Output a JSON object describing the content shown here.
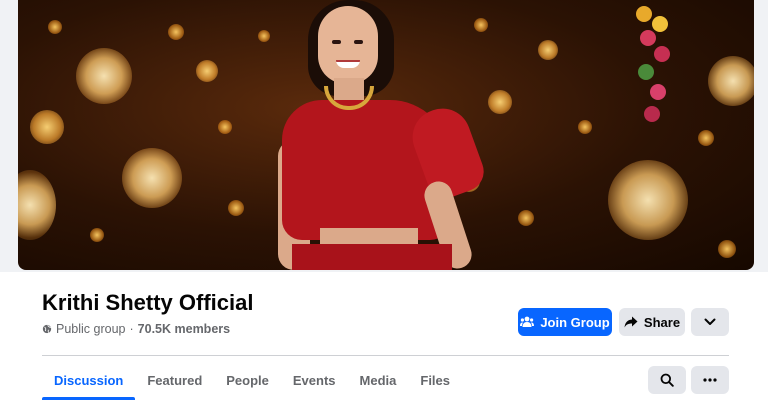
{
  "group": {
    "name": "Krithi Shetty Official",
    "privacy": "Public group",
    "separator": "·",
    "members": "70.5K members"
  },
  "actions": {
    "join_label": "Join Group",
    "share_label": "Share"
  },
  "tabs": [
    {
      "label": "Discussion",
      "active": true
    },
    {
      "label": "Featured",
      "active": false
    },
    {
      "label": "People",
      "active": false
    },
    {
      "label": "Events",
      "active": false
    },
    {
      "label": "Media",
      "active": false
    },
    {
      "label": "Files",
      "active": false
    }
  ],
  "icons": {
    "privacy": "globe-icon",
    "join": "group-people-icon",
    "share": "share-arrow-icon",
    "expand": "chevron-down-icon",
    "search": "search-icon",
    "more": "more-dots-icon"
  },
  "colors": {
    "accent": "#0866ff",
    "secondary_button": "#e4e6eb",
    "muted_text": "#65676b",
    "primary_text": "#050505"
  }
}
